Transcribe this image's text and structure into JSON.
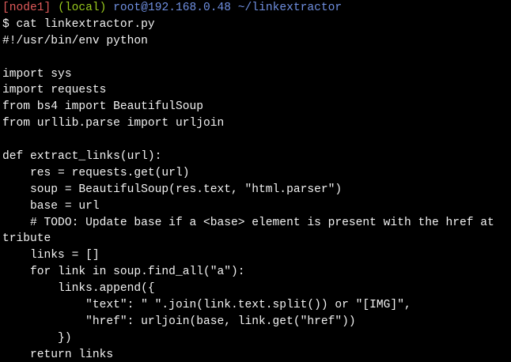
{
  "terminal": {
    "prompt": {
      "node": "[node1]",
      "local": "(local)",
      "host": "root@192.168.0.48 ~/linkextractor"
    },
    "colors": {
      "background": "#000000",
      "text": "#f2f2f2",
      "node": "#e05a5a",
      "local": "#98c91d",
      "host": "#6f8fe0"
    },
    "command": "$ cat linkextractor.py",
    "lines": [
      "#!/usr/bin/env python",
      "",
      "import sys",
      "import requests",
      "from bs4 import BeautifulSoup",
      "from urllib.parse import urljoin",
      "",
      "def extract_links(url):",
      "    res = requests.get(url)",
      "    soup = BeautifulSoup(res.text, \"html.parser\")",
      "    base = url",
      "    # TODO: Update base if a <base> element is present with the href at",
      "tribute",
      "    links = []",
      "    for link in soup.find_all(\"a\"):",
      "        links.append({",
      "            \"text\": \" \".join(link.text.split()) or \"[IMG]\",",
      "            \"href\": urljoin(base, link.get(\"href\"))",
      "        })",
      "    return links"
    ]
  }
}
